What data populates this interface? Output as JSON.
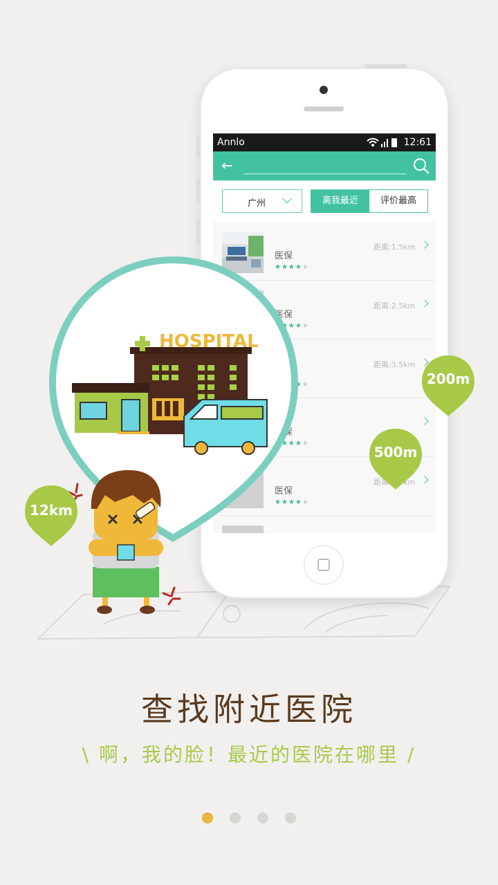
{
  "status_bar": {
    "carrier": "Annlo",
    "time": "12:61"
  },
  "app_bar": {
    "back_icon": "arrow-left-icon",
    "search_icon": "search-icon"
  },
  "filters": {
    "city": "广州",
    "sort_tabs": [
      {
        "label": "离我最近",
        "active": true
      },
      {
        "label": "评价最高",
        "active": false
      }
    ]
  },
  "hospitals": [
    {
      "insurance": "医保",
      "rating": 4,
      "distance": "距离:1.5km"
    },
    {
      "insurance": "医保",
      "rating": 4,
      "distance": "距离:2.5km"
    },
    {
      "insurance": "医保",
      "rating": 4,
      "distance": "距离:3.5km"
    },
    {
      "insurance": "医保",
      "rating": 4,
      "distance": ""
    },
    {
      "insurance": "医保",
      "rating": 4,
      "distance": "距离:5.5km"
    }
  ],
  "illustration": {
    "hospital_sign": "HOSPITAL",
    "distance_bubbles": [
      "200m",
      "500m",
      "12km"
    ]
  },
  "headline": "查找附近医院",
  "subline": "\\ 啊，我的脸！最近的医院在哪里 /",
  "pagination": {
    "total": 4,
    "current": 1
  },
  "colors": {
    "accent": "#42c2a0",
    "bubble": "#a7c947",
    "headline": "#5b3a1f",
    "dot_active": "#e9b53c"
  }
}
